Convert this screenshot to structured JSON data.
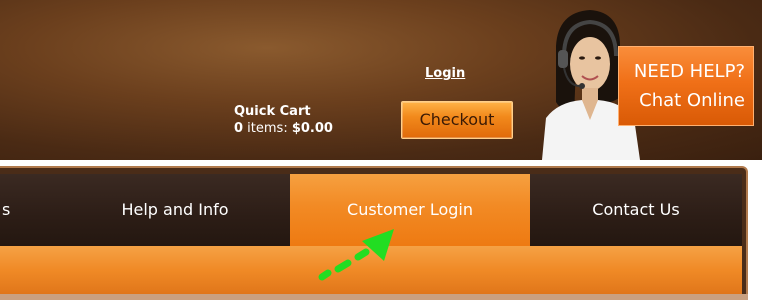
{
  "header": {
    "login_label": "Login",
    "checkout_label": "Checkout",
    "quick_cart": {
      "title": "Quick Cart",
      "item_count": "0",
      "items_label": " items: ",
      "total": "$0.00"
    },
    "help_button": {
      "line1": "NEED HELP?",
      "line2": "Chat Online"
    }
  },
  "nav": {
    "tabs": [
      {
        "label": "s"
      },
      {
        "label": "Help and Info"
      },
      {
        "label": "Customer Login"
      },
      {
        "label": "Contact Us"
      }
    ],
    "active_tab": "Customer Login"
  },
  "annotation": {
    "arrow_color": "#22dd22"
  },
  "colors": {
    "header_brown": "#5a351a",
    "accent_orange": "#f28a24",
    "nav_dark": "#2c1d16"
  }
}
